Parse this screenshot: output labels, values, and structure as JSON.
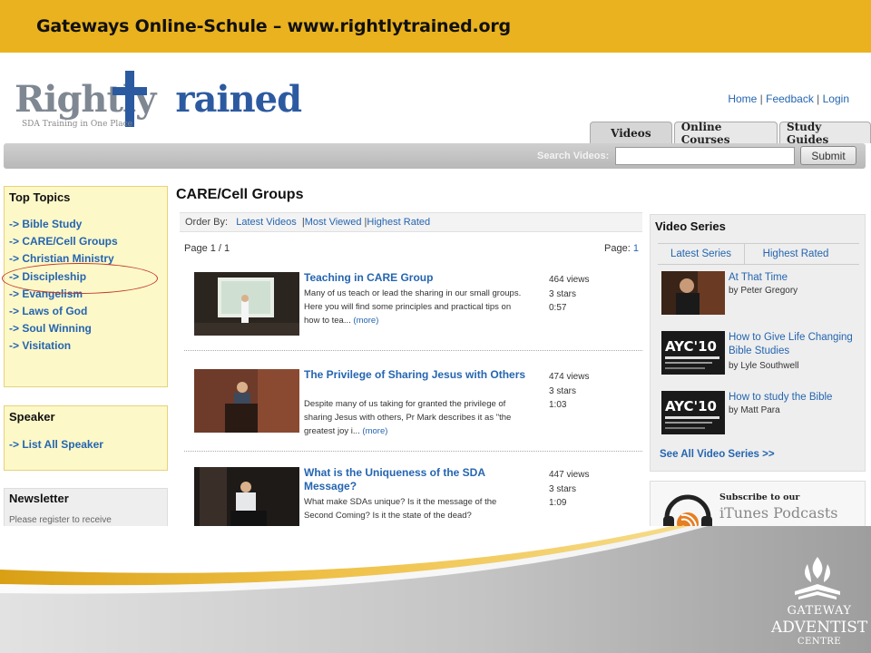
{
  "slide": {
    "title": "Gateways Online-Schule – www.rightlytrained.org"
  },
  "site": {
    "logo_word_plain": "Rightly",
    "logo_word_accent": "rained",
    "tagline": "SDA Training in One Place",
    "top_links": [
      "Home",
      "Feedback",
      "Login"
    ],
    "tabs": [
      "Videos",
      "Online Courses",
      "Study Guides"
    ],
    "search_label": "Search Videos:",
    "search_submit": "Submit"
  },
  "sidebar": {
    "topics_heading": "Top Topics",
    "topics": [
      "-> Bible Study",
      "-> CARE/Cell Groups",
      "-> Christian Ministry",
      "-> Discipleship",
      "-> Evangelism",
      "-> Laws of God",
      "->  Soul Winning",
      "-> Visitation"
    ],
    "speaker_heading": "Speaker",
    "speaker_link": "-> List All Speaker",
    "newsletter_heading": "Newsletter",
    "newsletter_snippet": "Please register to receive"
  },
  "main": {
    "heading": "CARE/Cell Groups",
    "order_by_label": "Order By:",
    "order_options": [
      "Latest Videos",
      "Most Viewed",
      "Highest Rated"
    ],
    "page_left": "Page 1 / 1",
    "page_right_label": "Page:",
    "page_right_num": "1",
    "videos": [
      {
        "title": "Teaching in CARE Group",
        "desc": "Many of us teach or lead the sharing in our small groups. Here you will find some principles and practical tips on how to tea...",
        "more": "(more)",
        "views": "464 views",
        "stars": "3 stars",
        "duration": "0:57"
      },
      {
        "title": "The Privilege of Sharing Jesus with Others",
        "desc": "Despite many of us taking for granted the privilege of sharing Jesus with others, Pr Mark describes it as \"the greatest joy i...",
        "more": "(more)",
        "views": "474 views",
        "stars": "3 stars",
        "duration": "1:03"
      },
      {
        "title": "What is the Uniqueness of the SDA Message?",
        "desc": "What make SDAs unique? Is it the message of the Second Coming? Is it the state of the dead?",
        "more": "",
        "views": "447 views",
        "stars": "3 stars",
        "duration": "1:09"
      }
    ]
  },
  "series": {
    "heading": "Video Series",
    "tabs": [
      "Latest Series",
      "Highest Rated"
    ],
    "items": [
      {
        "title": "At That Time",
        "author": "by Peter Gregory"
      },
      {
        "title": "How to Give Life Changing Bible Studies",
        "author": "by Lyle Southwell",
        "thumb_text": "AYC'10"
      },
      {
        "title": "How to study the Bible",
        "author": "by Matt Para",
        "thumb_text": "AYC'10"
      }
    ],
    "see_all": "See All Video Series >>"
  },
  "podcast": {
    "subscribe": "Subscribe to our",
    "itunes": "iTunes Podcasts"
  },
  "footer_logo": {
    "line1": "GATEWAY",
    "line2": "ADVENTIST",
    "line3": "CENTRE"
  },
  "colors": {
    "header_gold": "#eab21e",
    "link_blue": "#2565b0",
    "sidebar_yellow": "#fdf8c8",
    "highlight_red": "#c0392b",
    "bottom_gray": "#a9a9a9"
  }
}
